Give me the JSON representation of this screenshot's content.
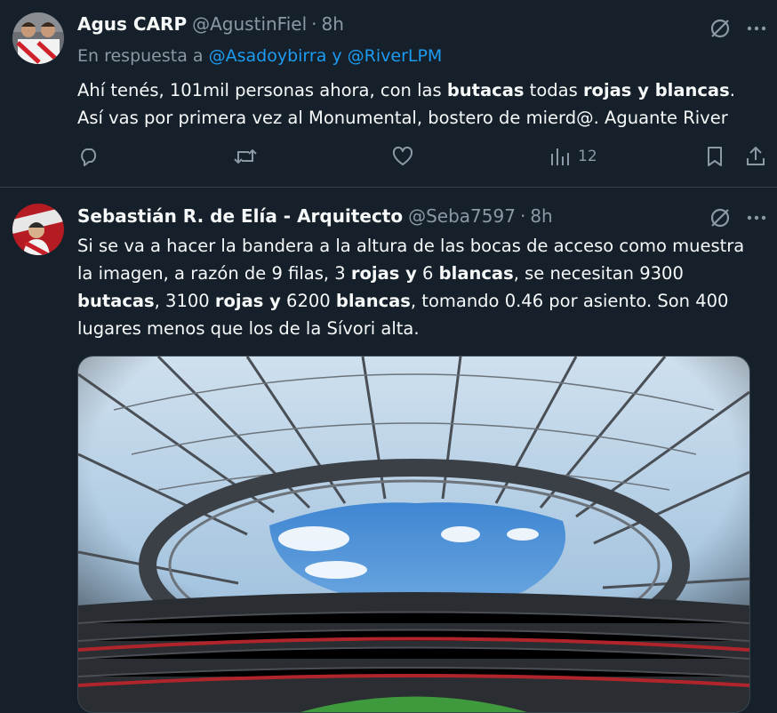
{
  "tweets": [
    {
      "name": "Agus CARP",
      "handle": "@AgustinFiel",
      "time": "8h",
      "reply_prefix": "En respuesta a",
      "reply_to": "@Asadoybirra y @RiverLPM",
      "text": {
        "p1": "Ahí tenés, 101mil personas ahora, con las ",
        "b1": "butacas",
        "p2": " todas ",
        "b2": "rojas y blancas",
        "p3": ". Así vas por primera vez al Monumental, bostero de mierd@. Aguante River"
      },
      "views": "12"
    },
    {
      "name": "Sebastián R. de Elía - Arquitecto",
      "handle": "@Seba7597",
      "time": "8h",
      "text": {
        "p1": "Si se va a hacer la bandera a la altura de las bocas de acceso como muestra la imagen, a razón de 9 filas, 3 ",
        "b1": "rojas y",
        "p2": " 6 ",
        "b2": "blancas",
        "p3": ", se necesitan 9300 ",
        "b3": "butacas",
        "p4": ", 3100 ",
        "b4": "rojas y",
        "p5": " 6200 ",
        "b5": "blancas",
        "p6": ", tomando 0.46 por asiento. Son 400 lugares menos que los de la Sívori alta."
      }
    }
  ],
  "icons": [
    "grok-icon",
    "more-icon",
    "reply-icon",
    "retweet-icon",
    "like-icon",
    "views-icon",
    "bookmark-icon",
    "share-icon"
  ],
  "colors": {
    "bg": "#15202b",
    "link": "#1d9bf0",
    "muted": "#8b98a5",
    "divider": "#38444d"
  }
}
